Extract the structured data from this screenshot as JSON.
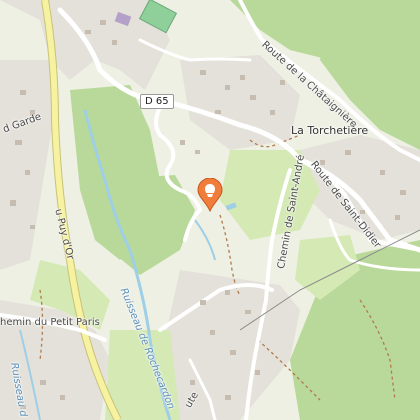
{
  "map": {
    "labels": {
      "route_chataigniere": "Route de la Châtaignière",
      "d65": "D 65",
      "la_torchetiere": "La Torchetière",
      "route_saint_didier": "Route de Saint-Didier",
      "chemin_saint_andre": "Chemin de Saint-André",
      "puy_d_or": "u Puy d'Or",
      "chemin_petit_paris": "hemin du Petit Paris",
      "ruisseau_rochecardon": "Ruisseau de Rochecardon",
      "ruisseau_left": "Ruisseau d",
      "garde": "d Garde",
      "bottom_fragment": "ute"
    },
    "colors": {
      "background": "#eef0e4",
      "forest": "#b9d99a",
      "meadow": "#d4e9b4",
      "urban": "#e4e1da",
      "building": "#c7bcb0",
      "road": "#ffffff",
      "main_road": "#f6f2a0",
      "water": "#9ecfe6",
      "trail": "#b07a4a",
      "marker": "#f07d3c"
    },
    "icons": {
      "marker": "map-pin-icon"
    }
  }
}
